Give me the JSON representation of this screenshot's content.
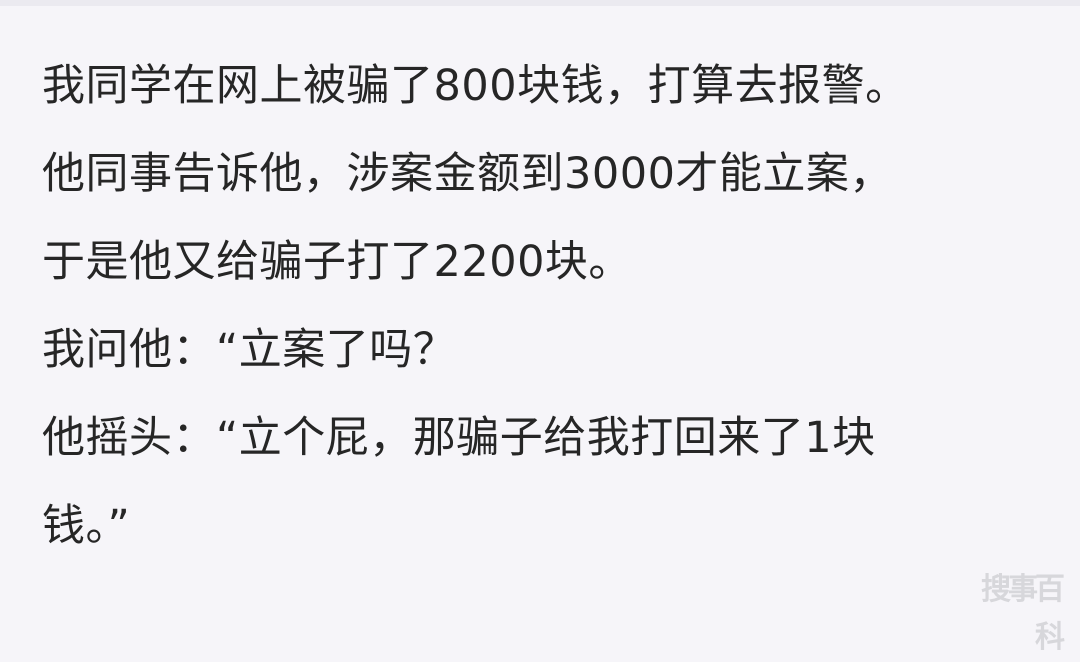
{
  "post": {
    "lines": [
      "我同学在网上被骗了800块钱，打算去报警。",
      "他同事告诉他，涉案金额到3000才能立案，",
      "于是他又给骗子打了2200块。",
      "我问他：“立案了吗？",
      "他摇头：“立个屁，那骗子给我打回来了1块",
      "钱。”"
    ]
  },
  "watermark": {
    "text": "搜事百科"
  }
}
